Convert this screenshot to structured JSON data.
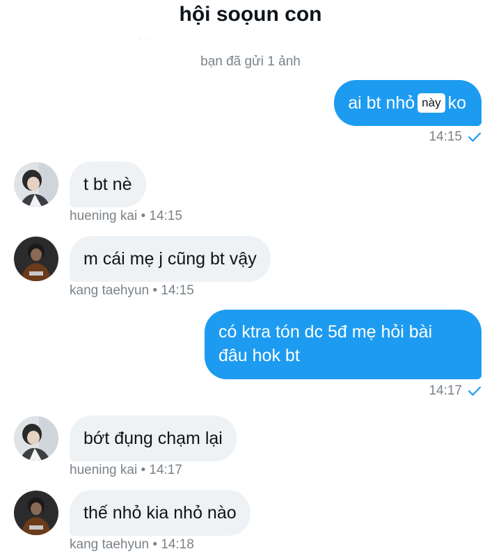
{
  "header": {
    "title": "hội soọun con"
  },
  "system_note": "bạn đã gửi 1 ảnh",
  "messages": [
    {
      "sender": "me",
      "text_before": "ai bt nhỏ",
      "sticker": "này",
      "text_after": "ko",
      "time": "14:15"
    },
    {
      "sender": "huening kai",
      "text": "t bt nè",
      "meta": "huening kai • 14:15",
      "avatar": "avatar-huening-kai"
    },
    {
      "sender": "kang taehyun",
      "text": "m cái mẹ j cũng bt vậy",
      "meta": "kang taehyun • 14:15",
      "avatar": "avatar-kang-taehyun"
    },
    {
      "sender": "me",
      "line1": "có ktra tón dc 5đ mẹ hỏi bài",
      "line2": "đâu hok bt",
      "time": "14:17"
    },
    {
      "sender": "huening kai",
      "text": "bớt đụng chạm lại",
      "meta": "huening kai • 14:17",
      "avatar": "avatar-huening-kai"
    },
    {
      "sender": "kang taehyun",
      "text": "thế nhỏ kia nhỏ nào",
      "meta": "kang taehyun • 14:18",
      "avatar": "avatar-kang-taehyun"
    }
  ],
  "icons": {
    "read_receipt": "check-icon"
  },
  "colors": {
    "outgoing_bubble": "#1d9bf0",
    "incoming_bubble": "#eff2f5",
    "meta_text": "#7a8288",
    "check": "#1d9bf0"
  }
}
